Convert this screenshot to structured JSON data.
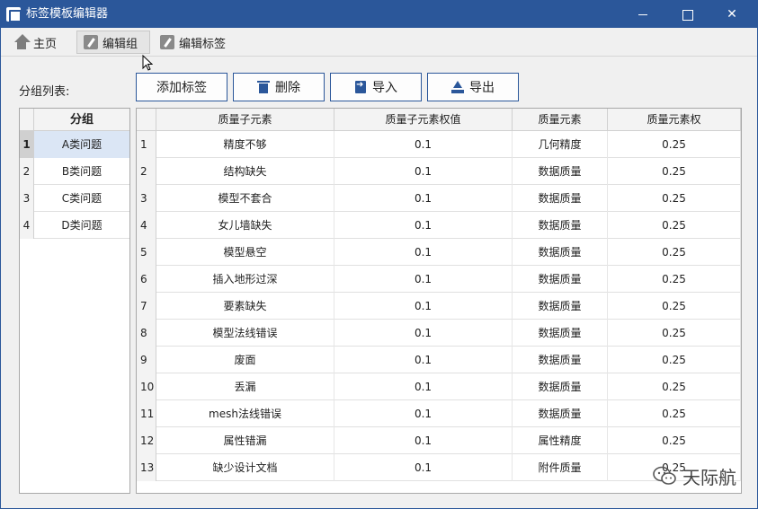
{
  "window": {
    "title": "标签模板编辑器"
  },
  "toolbar": {
    "tabs": [
      {
        "label": "主页",
        "icon": "home-icon"
      },
      {
        "label": "编辑组",
        "icon": "edit-icon",
        "active": true
      },
      {
        "label": "编辑标签",
        "icon": "edit-icon"
      }
    ]
  },
  "group_panel": {
    "label": "分组列表:",
    "header": "分组",
    "rows": [
      {
        "num": "1",
        "name": "A类问题",
        "selected": true
      },
      {
        "num": "2",
        "name": "B类问题"
      },
      {
        "num": "3",
        "name": "C类问题"
      },
      {
        "num": "4",
        "name": "D类问题"
      }
    ]
  },
  "actions": {
    "add_label": "添加标签",
    "delete_label": "删除",
    "import_label": "导入",
    "export_label": "导出"
  },
  "tag_table": {
    "columns": [
      "质量子元素",
      "质量子元素权值",
      "质量元素",
      "质量元素权"
    ],
    "rows": [
      {
        "num": "1",
        "sub": "精度不够",
        "sub_w": "0.1",
        "elem": "几何精度",
        "elem_w": "0.25"
      },
      {
        "num": "2",
        "sub": "结构缺失",
        "sub_w": "0.1",
        "elem": "数据质量",
        "elem_w": "0.25"
      },
      {
        "num": "3",
        "sub": "模型不套合",
        "sub_w": "0.1",
        "elem": "数据质量",
        "elem_w": "0.25"
      },
      {
        "num": "4",
        "sub": "女儿墙缺失",
        "sub_w": "0.1",
        "elem": "数据质量",
        "elem_w": "0.25"
      },
      {
        "num": "5",
        "sub": "模型悬空",
        "sub_w": "0.1",
        "elem": "数据质量",
        "elem_w": "0.25"
      },
      {
        "num": "6",
        "sub": "插入地形过深",
        "sub_w": "0.1",
        "elem": "数据质量",
        "elem_w": "0.25"
      },
      {
        "num": "7",
        "sub": "要素缺失",
        "sub_w": "0.1",
        "elem": "数据质量",
        "elem_w": "0.25"
      },
      {
        "num": "8",
        "sub": "模型法线错误",
        "sub_w": "0.1",
        "elem": "数据质量",
        "elem_w": "0.25"
      },
      {
        "num": "9",
        "sub": "废面",
        "sub_w": "0.1",
        "elem": "数据质量",
        "elem_w": "0.25"
      },
      {
        "num": "10",
        "sub": "丢漏",
        "sub_w": "0.1",
        "elem": "数据质量",
        "elem_w": "0.25"
      },
      {
        "num": "11",
        "sub": "mesh法线错误",
        "sub_w": "0.1",
        "elem": "数据质量",
        "elem_w": "0.25"
      },
      {
        "num": "12",
        "sub": "属性错漏",
        "sub_w": "0.1",
        "elem": "属性精度",
        "elem_w": "0.25"
      },
      {
        "num": "13",
        "sub": "缺少设计文档",
        "sub_w": "0.1",
        "elem": "附件质量",
        "elem_w": "0.25"
      }
    ]
  },
  "watermark": {
    "text": "天际航",
    "icon": "wechat-icon"
  },
  "colors": {
    "titlebar": "#2b579a",
    "selection": "#dbe6f5"
  }
}
